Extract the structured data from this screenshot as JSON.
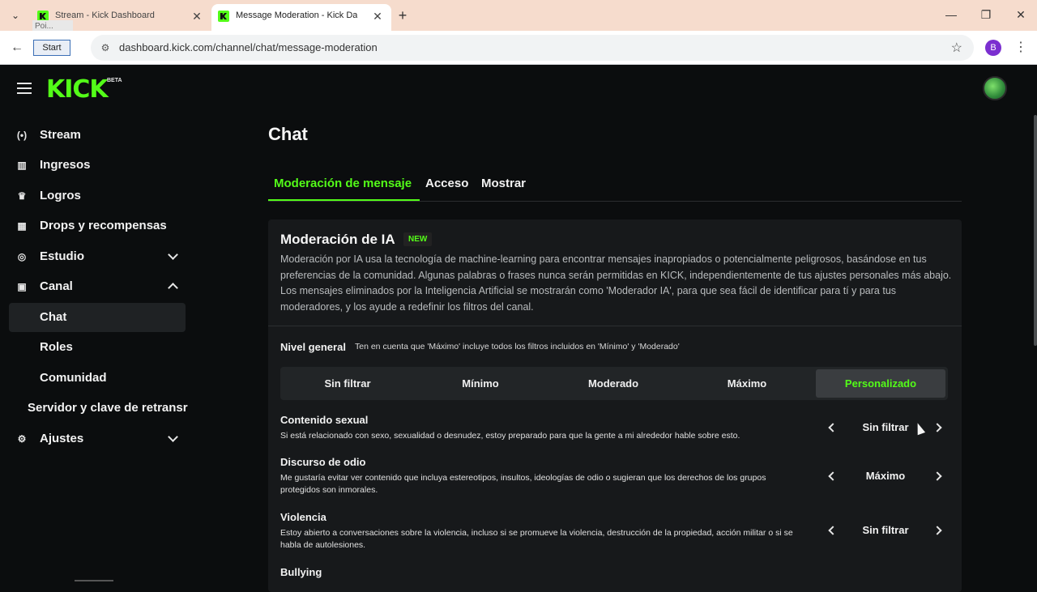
{
  "browser": {
    "tabs": [
      {
        "title": "Stream - Kick Dashboard",
        "active": false
      },
      {
        "title": "Message Moderation - Kick Dashboard",
        "active": true
      }
    ],
    "tooltip": "Poi...",
    "start_label": "Start",
    "url": "dashboard.kick.com/channel/chat/message-moderation",
    "profile_initial": "B",
    "new_tab": "+",
    "min": "—",
    "restore": "❐",
    "close": "✕"
  },
  "app": {
    "logo": "KICK",
    "beta": "BETA",
    "accent": "#53fc18"
  },
  "sidebar": {
    "items": [
      {
        "label": "Stream",
        "icon": "broadcast-icon"
      },
      {
        "label": "Ingresos",
        "icon": "chart-icon"
      },
      {
        "label": "Logros",
        "icon": "trophy-icon"
      },
      {
        "label": "Drops y recompensas",
        "icon": "gift-icon"
      },
      {
        "label": "Estudio",
        "icon": "studio-icon"
      },
      {
        "label": "Canal",
        "icon": "channel-icon"
      },
      {
        "label": "Chat"
      },
      {
        "label": "Roles"
      },
      {
        "label": "Comunidad"
      },
      {
        "label": "Servidor y clave de retransr"
      },
      {
        "label": "Ajustes",
        "icon": "gear-icon"
      }
    ]
  },
  "main": {
    "title": "Chat",
    "tabs": [
      {
        "label": "Moderación de mensaje",
        "active": true
      },
      {
        "label": "Acceso",
        "active": false
      },
      {
        "label": "Mostrar",
        "active": false
      }
    ],
    "ai": {
      "title": "Moderación de IA",
      "badge": "NEW",
      "description": "Moderación por IA usa la tecnología de machine-learning para encontrar mensajes inapropiados o potencialmente peligrosos, basándose en tus preferencias de la comunidad. Algunas palabras o frases nunca serán permitidas en KICK, independientemente de tus ajustes personales más abajo. Los mensajes eliminados por la Inteligencia Artificial se mostrarán como 'Moderador IA', para que sea fácil de identificar para tí y para tus moderadores, y los ayude a redefinir los filtros del canal."
    },
    "nivel": {
      "label": "Nivel general",
      "note": "Ten en cuenta que 'Máximo' incluye todos los filtros incluidos en 'Mínimo' y 'Moderado'",
      "options": [
        "Sin filtrar",
        "Mínimo",
        "Moderado",
        "Máximo",
        "Personalizado"
      ],
      "selected": "Personalizado"
    },
    "categories": [
      {
        "title": "Contenido sexual",
        "desc": "Si está relacionado con sexo, sexualidad o desnudez, estoy preparado para que la gente a mi alrededor hable sobre esto.",
        "value": "Sin filtrar"
      },
      {
        "title": "Discurso de odio",
        "desc": "Me gustaría evitar ver contenido que incluya estereotipos, insultos, ideologías de odio o sugieran que los derechos de los grupos protegidos son inmorales.",
        "value": "Máximo"
      },
      {
        "title": "Violencia",
        "desc": "Estoy abierto a conversaciones sobre la violencia, incluso si se promueve la violencia, destrucción de la propiedad, acción militar o si se habla de autolesiones.",
        "value": "Sin filtrar"
      },
      {
        "title": "Bullying",
        "desc": "",
        "value": ""
      }
    ]
  }
}
